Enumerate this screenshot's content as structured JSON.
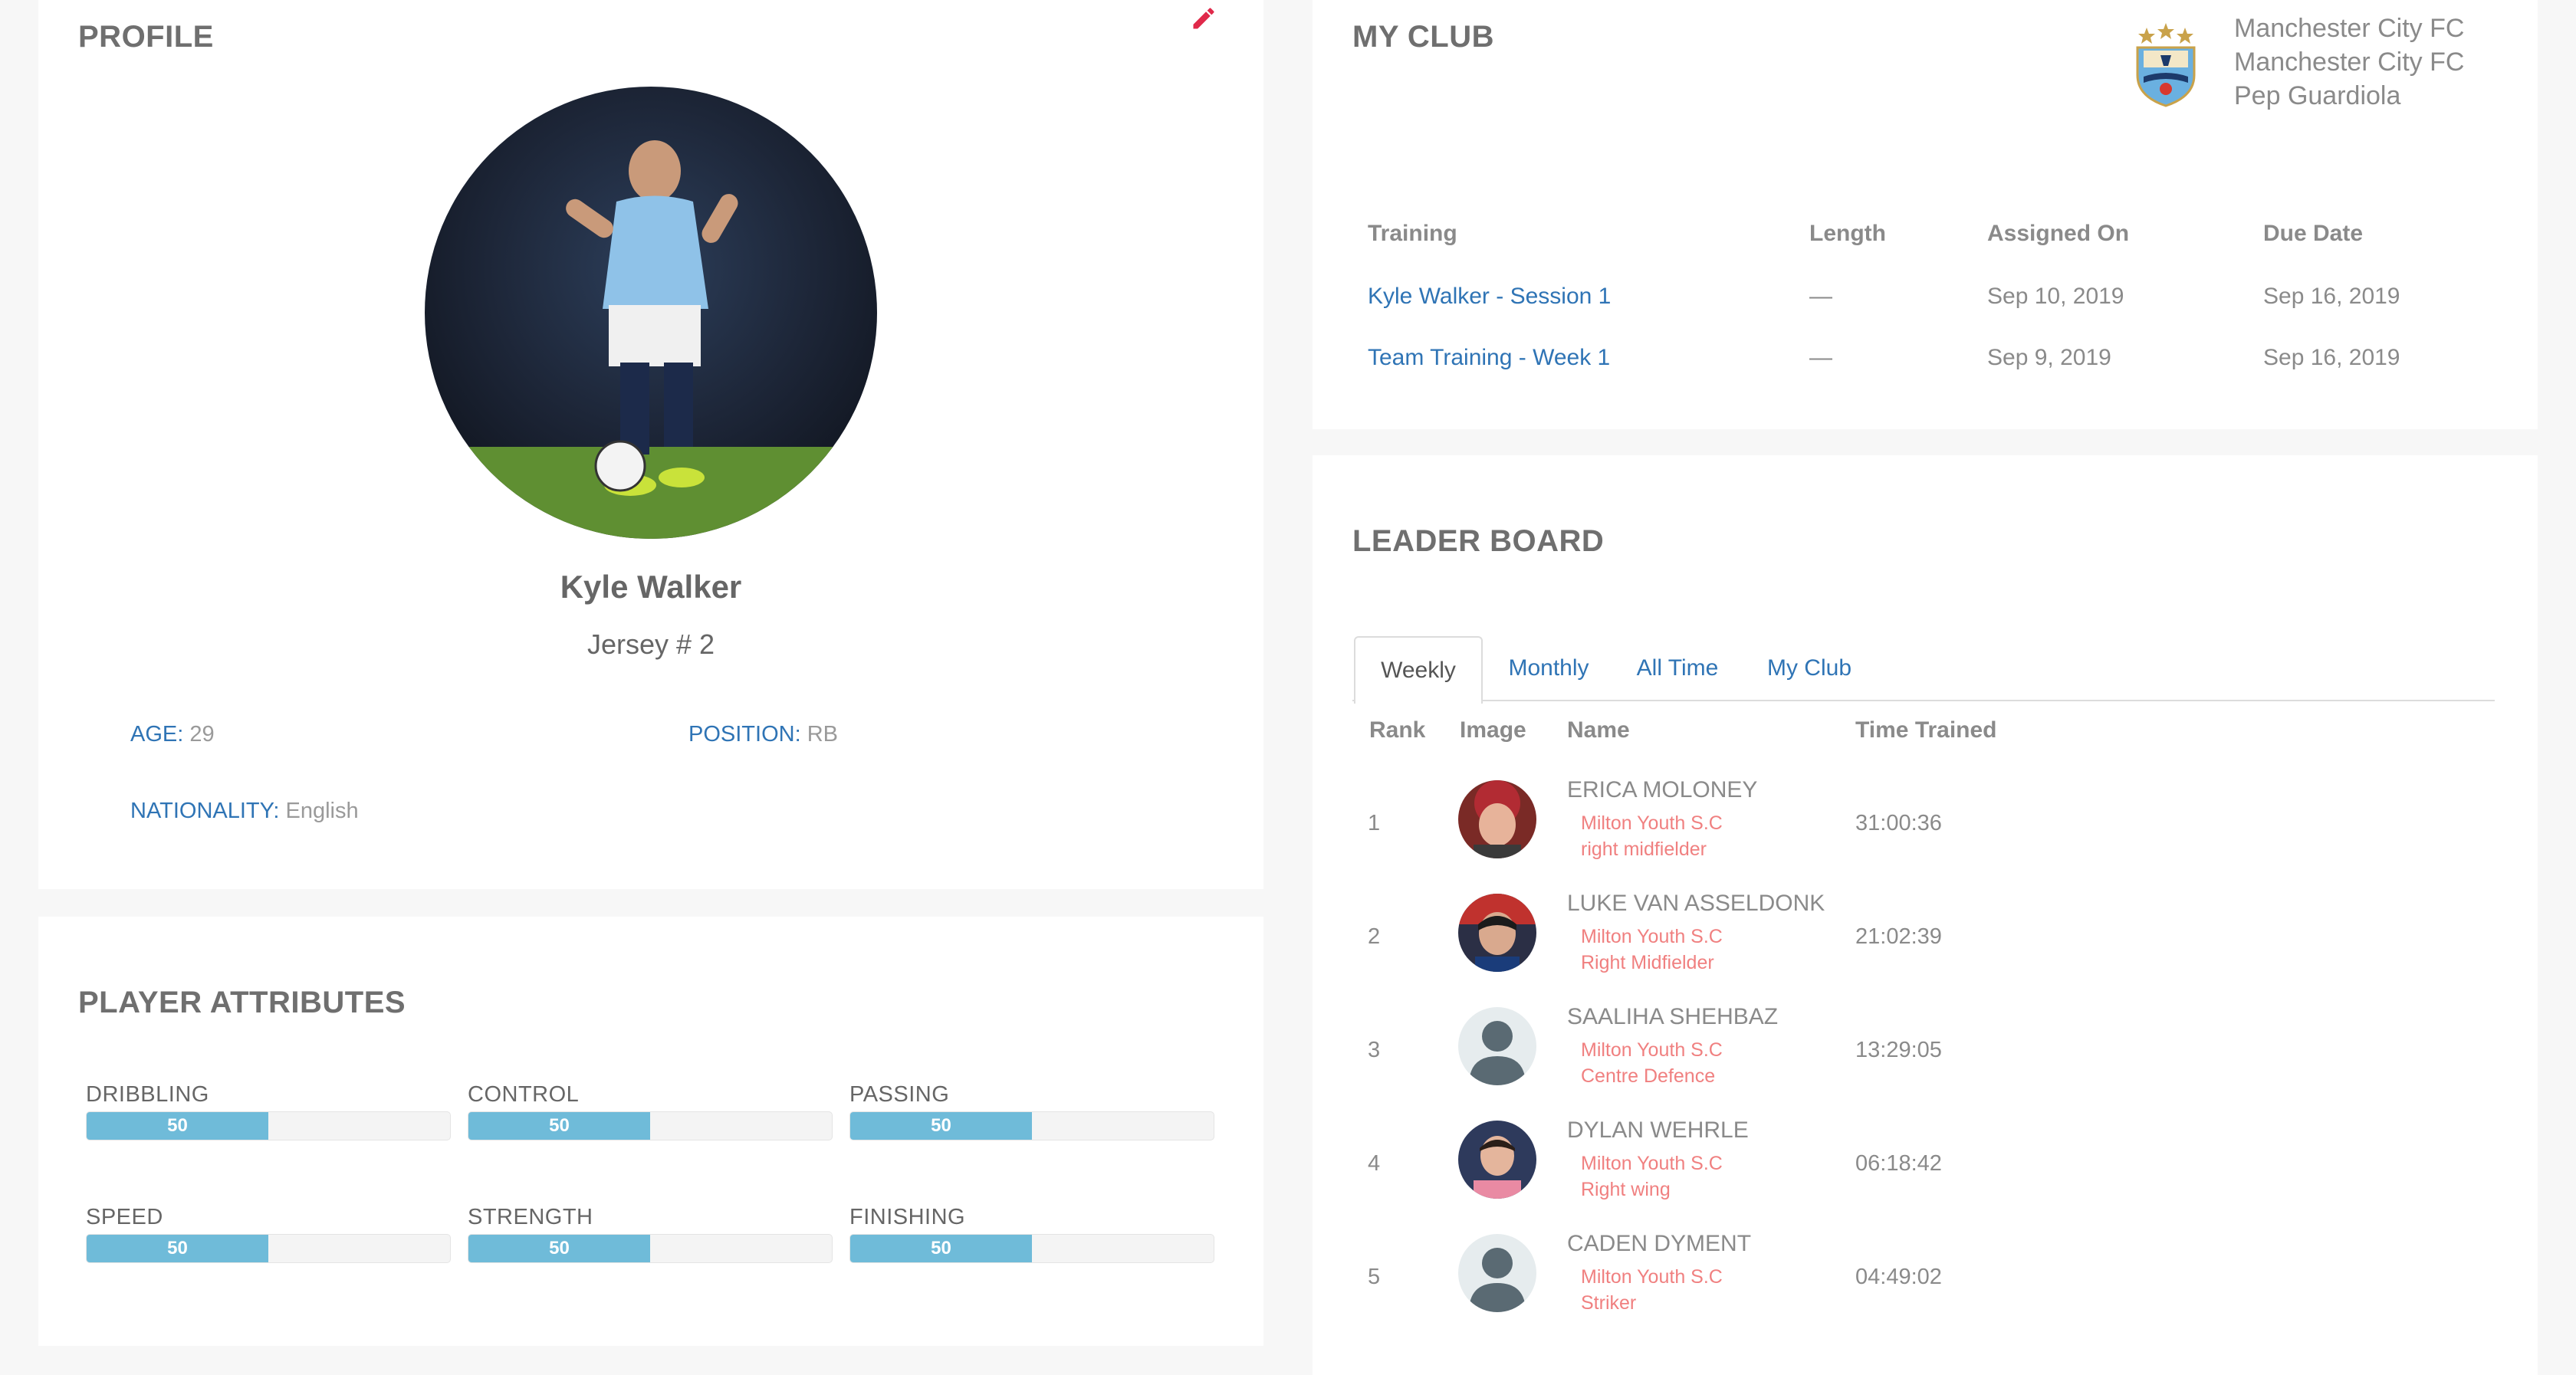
{
  "profile": {
    "title": "PROFILE",
    "name": "Kyle Walker",
    "jersey": "Jersey # 2",
    "age_label": "AGE:",
    "age_value": "29",
    "position_label": "POSITION:",
    "position_value": "RB",
    "nationality_label": "NATIONALITY:",
    "nationality_value": "English"
  },
  "attributes": {
    "title": "PLAYER ATTRIBUTES",
    "items": [
      {
        "label": "DRIBBLING",
        "value": "50",
        "fraction": 0.5
      },
      {
        "label": "CONTROL",
        "value": "50",
        "fraction": 0.5
      },
      {
        "label": "PASSING",
        "value": "50",
        "fraction": 0.5
      },
      {
        "label": "SPEED",
        "value": "50",
        "fraction": 0.5
      },
      {
        "label": "STRENGTH",
        "value": "50",
        "fraction": 0.5
      },
      {
        "label": "FINISHING",
        "value": "50",
        "fraction": 0.5
      }
    ]
  },
  "club": {
    "title": "MY CLUB",
    "lines": [
      "Manchester City FC",
      "Manchester City FC",
      "Pep Guardiola"
    ],
    "table": {
      "headers": [
        "Training",
        "Length",
        "Assigned On",
        "Due Date"
      ],
      "rows": [
        [
          "Kyle Walker - Session 1",
          "—",
          "Sep 10, 2019",
          "Sep 16, 2019"
        ],
        [
          "Team Training - Week 1",
          "—",
          "Sep 9, 2019",
          "Sep 16, 2019"
        ]
      ]
    }
  },
  "leaderboard": {
    "title": "LEADER BOARD",
    "tabs": [
      "Weekly",
      "Monthly",
      "All Time",
      "My Club"
    ],
    "active_tab": "Weekly",
    "headers": [
      "Rank",
      "Image",
      "Name",
      "Time Trained"
    ],
    "rows": [
      {
        "rank": "1",
        "name": "ERICA MOLONEY",
        "club": "Milton Youth S.C",
        "position": "right midfielder",
        "time": "31:00:36",
        "avatar": "photo-red"
      },
      {
        "rank": "2",
        "name": "LUKE VAN ASSELDONK",
        "club": "Milton Youth S.C",
        "position": "Right Midfielder",
        "time": "21:02:39",
        "avatar": "photo-dark"
      },
      {
        "rank": "3",
        "name": "SAALIHA SHEHBAZ",
        "club": "Milton Youth S.C",
        "position": "Centre Defence",
        "time": "13:29:05",
        "avatar": "placeholder"
      },
      {
        "rank": "4",
        "name": "DYLAN WEHRLE",
        "club": "Milton Youth S.C",
        "position": "Right wing",
        "time": "06:18:42",
        "avatar": "photo-pink"
      },
      {
        "rank": "5",
        "name": "CADEN DYMENT",
        "club": "Milton Youth S.C",
        "position": "Striker",
        "time": "04:49:02",
        "avatar": "placeholder"
      }
    ]
  },
  "colors": {
    "link": "#2f74b5",
    "attr_fill": "#6fbbd9",
    "subtext": "#f08080",
    "edit_icon": "#e0294a"
  }
}
